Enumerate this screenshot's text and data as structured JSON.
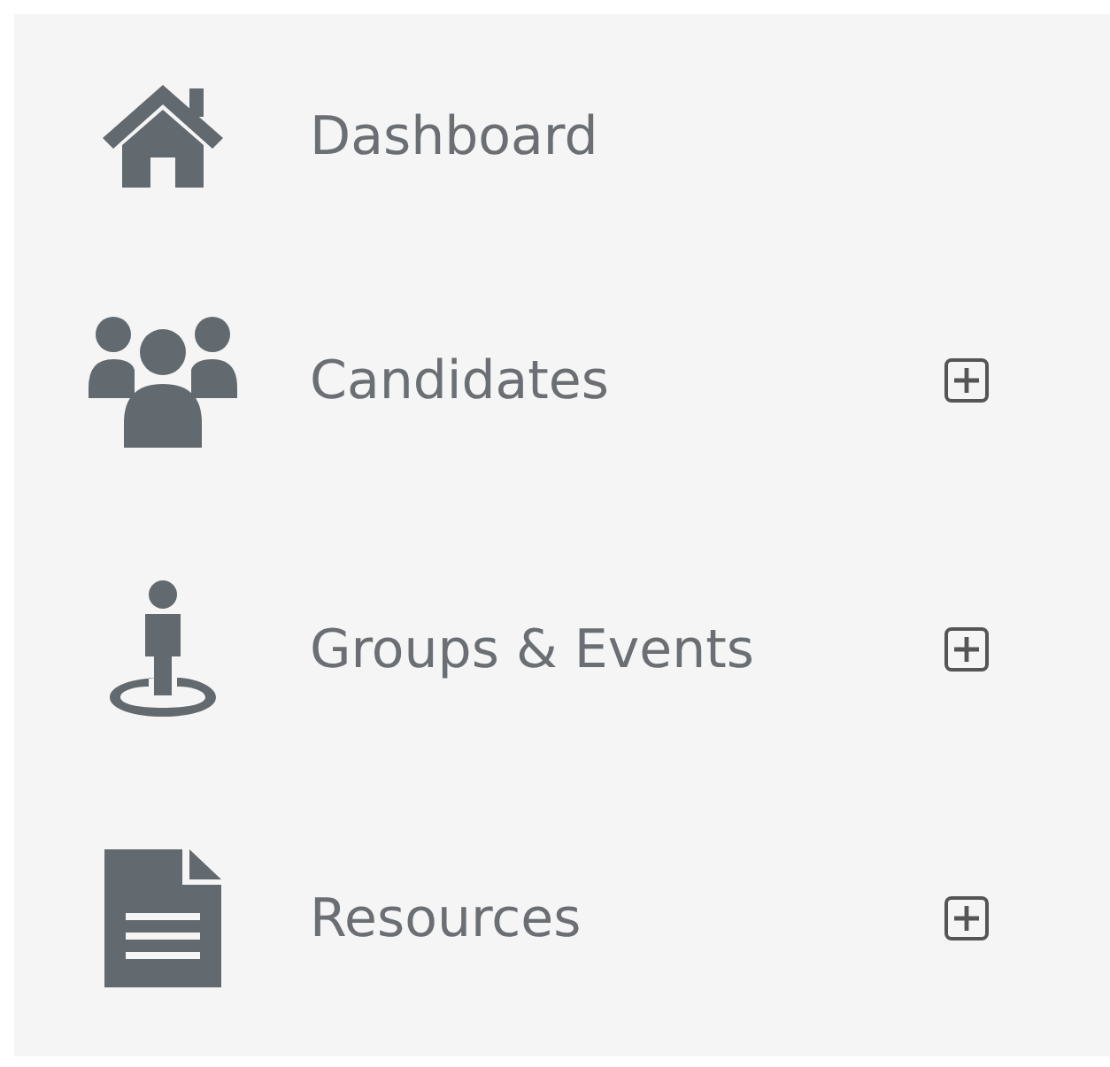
{
  "sidebar": {
    "items": [
      {
        "label": "Dashboard",
        "expandable": false
      },
      {
        "label": "Candidates",
        "expandable": true
      },
      {
        "label": "Groups & Events",
        "expandable": true
      },
      {
        "label": "Resources",
        "expandable": true
      }
    ]
  }
}
